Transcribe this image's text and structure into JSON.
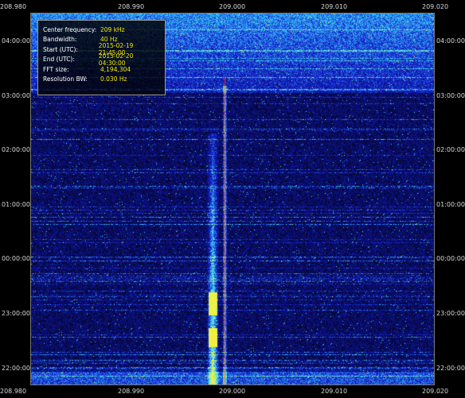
{
  "spectrogram": {
    "x_axis_labels": [
      "208.980",
      "208.990",
      "209.000",
      "209.010",
      "209.020"
    ],
    "y_axis_labels": [
      "04:00:00",
      "03:00:00",
      "02:00:00",
      "01:00:00",
      "00:00:00",
      "23:00:00",
      "22:00:00"
    ],
    "info_box": [
      {
        "key": "Center frequency:",
        "value": "209 kHz"
      },
      {
        "key": "Bandwidth:",
        "value": "40 Hz"
      },
      {
        "key": "Start (UTC):",
        "value": "2015-02-19 21:45:00"
      },
      {
        "key": "End (UTC):",
        "value": "2015-02-20 04:30:00"
      },
      {
        "key": "FFT size:",
        "value": "4,194,304"
      },
      {
        "key": "Resolution BW:",
        "value": "0.030 Hz"
      }
    ],
    "colors": {
      "background": "#000000",
      "noise_dark": "#02031a",
      "noise_blue": "#1a2ad0",
      "signal_cyan": "#40e0ff",
      "signal_yellow": "#f0e040",
      "carrier_red": "#ff3020",
      "info_value": "#f0e600"
    }
  }
}
